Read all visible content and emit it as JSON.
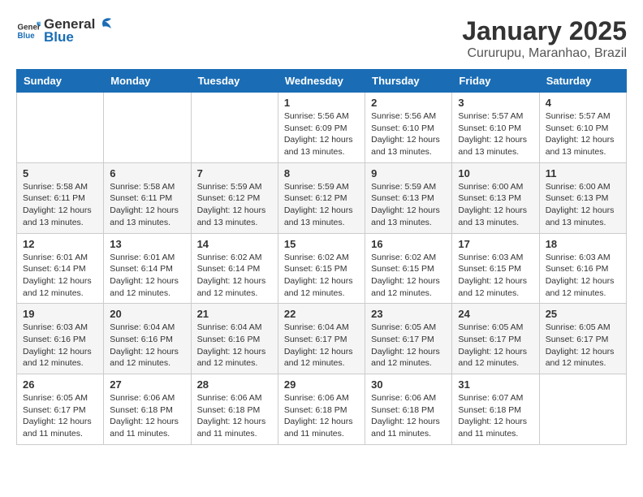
{
  "header": {
    "logo_general": "General",
    "logo_blue": "Blue",
    "title": "January 2025",
    "subtitle": "Cururupu, Maranhao, Brazil"
  },
  "days_of_week": [
    "Sunday",
    "Monday",
    "Tuesday",
    "Wednesday",
    "Thursday",
    "Friday",
    "Saturday"
  ],
  "weeks": [
    [
      {
        "day": "",
        "info": ""
      },
      {
        "day": "",
        "info": ""
      },
      {
        "day": "",
        "info": ""
      },
      {
        "day": "1",
        "info": "Sunrise: 5:56 AM\nSunset: 6:09 PM\nDaylight: 12 hours\nand 13 minutes."
      },
      {
        "day": "2",
        "info": "Sunrise: 5:56 AM\nSunset: 6:10 PM\nDaylight: 12 hours\nand 13 minutes."
      },
      {
        "day": "3",
        "info": "Sunrise: 5:57 AM\nSunset: 6:10 PM\nDaylight: 12 hours\nand 13 minutes."
      },
      {
        "day": "4",
        "info": "Sunrise: 5:57 AM\nSunset: 6:10 PM\nDaylight: 12 hours\nand 13 minutes."
      }
    ],
    [
      {
        "day": "5",
        "info": "Sunrise: 5:58 AM\nSunset: 6:11 PM\nDaylight: 12 hours\nand 13 minutes."
      },
      {
        "day": "6",
        "info": "Sunrise: 5:58 AM\nSunset: 6:11 PM\nDaylight: 12 hours\nand 13 minutes."
      },
      {
        "day": "7",
        "info": "Sunrise: 5:59 AM\nSunset: 6:12 PM\nDaylight: 12 hours\nand 13 minutes."
      },
      {
        "day": "8",
        "info": "Sunrise: 5:59 AM\nSunset: 6:12 PM\nDaylight: 12 hours\nand 13 minutes."
      },
      {
        "day": "9",
        "info": "Sunrise: 5:59 AM\nSunset: 6:13 PM\nDaylight: 12 hours\nand 13 minutes."
      },
      {
        "day": "10",
        "info": "Sunrise: 6:00 AM\nSunset: 6:13 PM\nDaylight: 12 hours\nand 13 minutes."
      },
      {
        "day": "11",
        "info": "Sunrise: 6:00 AM\nSunset: 6:13 PM\nDaylight: 12 hours\nand 13 minutes."
      }
    ],
    [
      {
        "day": "12",
        "info": "Sunrise: 6:01 AM\nSunset: 6:14 PM\nDaylight: 12 hours\nand 12 minutes."
      },
      {
        "day": "13",
        "info": "Sunrise: 6:01 AM\nSunset: 6:14 PM\nDaylight: 12 hours\nand 12 minutes."
      },
      {
        "day": "14",
        "info": "Sunrise: 6:02 AM\nSunset: 6:14 PM\nDaylight: 12 hours\nand 12 minutes."
      },
      {
        "day": "15",
        "info": "Sunrise: 6:02 AM\nSunset: 6:15 PM\nDaylight: 12 hours\nand 12 minutes."
      },
      {
        "day": "16",
        "info": "Sunrise: 6:02 AM\nSunset: 6:15 PM\nDaylight: 12 hours\nand 12 minutes."
      },
      {
        "day": "17",
        "info": "Sunrise: 6:03 AM\nSunset: 6:15 PM\nDaylight: 12 hours\nand 12 minutes."
      },
      {
        "day": "18",
        "info": "Sunrise: 6:03 AM\nSunset: 6:16 PM\nDaylight: 12 hours\nand 12 minutes."
      }
    ],
    [
      {
        "day": "19",
        "info": "Sunrise: 6:03 AM\nSunset: 6:16 PM\nDaylight: 12 hours\nand 12 minutes."
      },
      {
        "day": "20",
        "info": "Sunrise: 6:04 AM\nSunset: 6:16 PM\nDaylight: 12 hours\nand 12 minutes."
      },
      {
        "day": "21",
        "info": "Sunrise: 6:04 AM\nSunset: 6:16 PM\nDaylight: 12 hours\nand 12 minutes."
      },
      {
        "day": "22",
        "info": "Sunrise: 6:04 AM\nSunset: 6:17 PM\nDaylight: 12 hours\nand 12 minutes."
      },
      {
        "day": "23",
        "info": "Sunrise: 6:05 AM\nSunset: 6:17 PM\nDaylight: 12 hours\nand 12 minutes."
      },
      {
        "day": "24",
        "info": "Sunrise: 6:05 AM\nSunset: 6:17 PM\nDaylight: 12 hours\nand 12 minutes."
      },
      {
        "day": "25",
        "info": "Sunrise: 6:05 AM\nSunset: 6:17 PM\nDaylight: 12 hours\nand 12 minutes."
      }
    ],
    [
      {
        "day": "26",
        "info": "Sunrise: 6:05 AM\nSunset: 6:17 PM\nDaylight: 12 hours\nand 11 minutes."
      },
      {
        "day": "27",
        "info": "Sunrise: 6:06 AM\nSunset: 6:18 PM\nDaylight: 12 hours\nand 11 minutes."
      },
      {
        "day": "28",
        "info": "Sunrise: 6:06 AM\nSunset: 6:18 PM\nDaylight: 12 hours\nand 11 minutes."
      },
      {
        "day": "29",
        "info": "Sunrise: 6:06 AM\nSunset: 6:18 PM\nDaylight: 12 hours\nand 11 minutes."
      },
      {
        "day": "30",
        "info": "Sunrise: 6:06 AM\nSunset: 6:18 PM\nDaylight: 12 hours\nand 11 minutes."
      },
      {
        "day": "31",
        "info": "Sunrise: 6:07 AM\nSunset: 6:18 PM\nDaylight: 12 hours\nand 11 minutes."
      },
      {
        "day": "",
        "info": ""
      }
    ]
  ]
}
